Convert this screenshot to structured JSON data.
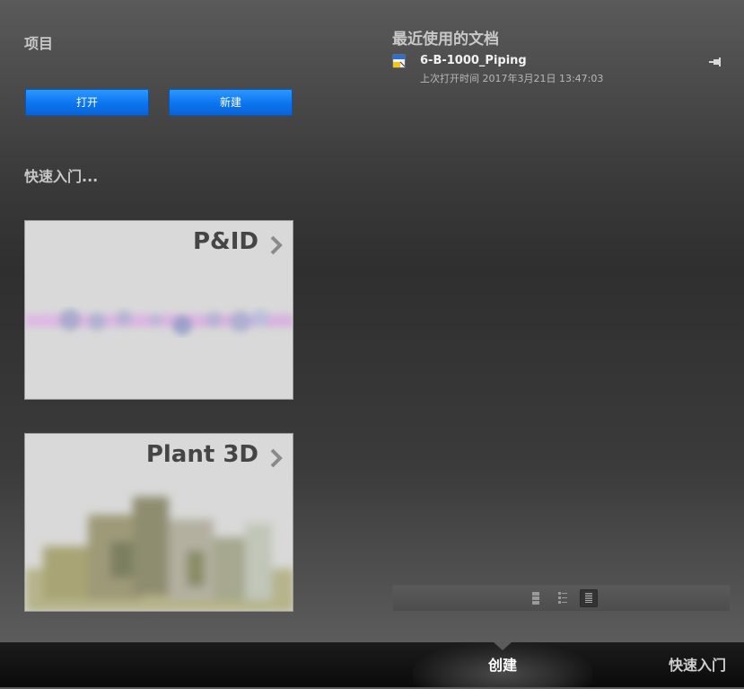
{
  "projects": {
    "title": "项目",
    "open_label": "打开",
    "new_label": "新建"
  },
  "quick_start": {
    "title": "快速入门...",
    "cards": [
      {
        "title": "P&ID"
      },
      {
        "title": "Plant 3D"
      }
    ]
  },
  "recent_docs": {
    "title": "最近使用的文档",
    "items": [
      {
        "name": "6-B-1000_Piping",
        "opened": "上次打开时间 2017年3月21日 13:47:03"
      }
    ]
  },
  "bottom_tabs": {
    "create": "创建",
    "quick_start": "快速入门"
  },
  "colors": {
    "accent": "#0b74f0"
  },
  "icons": {
    "document": "dwg-file-icon",
    "pin": "pin-icon",
    "view_modes": [
      "large-list-view-icon",
      "detail-list-view-icon",
      "compact-list-view-icon"
    ]
  }
}
